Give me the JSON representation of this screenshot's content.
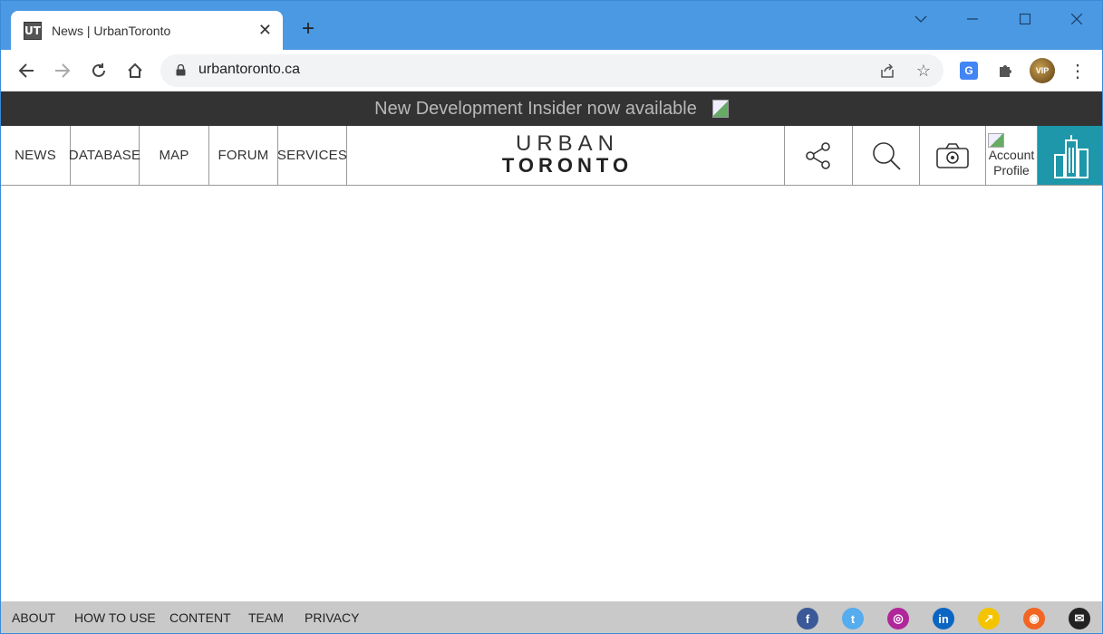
{
  "browser": {
    "tab_title": "News | UrbanToronto",
    "favicon_text": "UT",
    "url": "urbantoronto.ca",
    "avatar_text": "VIP"
  },
  "banner": {
    "text": "New Development Insider now available"
  },
  "nav": {
    "items": [
      "NEWS",
      "DATABASE",
      "MAP",
      "FORUM",
      "SERVICES"
    ],
    "logo_top": "URBAN",
    "logo_bottom": "TORONTO",
    "account_line1": "Account",
    "account_line2": "Profile"
  },
  "footer": {
    "links": [
      "ABOUT",
      "HOW TO USE",
      "CONTENT",
      "TEAM",
      "PRIVACY"
    ],
    "social": [
      {
        "icon": "facebook-icon",
        "glyph": "f",
        "color": "#3b5998"
      },
      {
        "icon": "twitter-icon",
        "glyph": "t",
        "color": "#55acee"
      },
      {
        "icon": "instagram-icon",
        "glyph": "◎",
        "color": "#b0279a"
      },
      {
        "icon": "linkedin-icon",
        "glyph": "in",
        "color": "#0a66c2"
      },
      {
        "icon": "trend-icon",
        "glyph": "↗",
        "color": "#f5c400"
      },
      {
        "icon": "rss-icon",
        "glyph": "◉",
        "color": "#f26522"
      },
      {
        "icon": "email-icon",
        "glyph": "✉",
        "color": "#222222"
      }
    ]
  },
  "colors": {
    "tabbar": "#4a99e2",
    "banner": "#333333",
    "accent": "#1e97aa",
    "footer": "#c9c9c9"
  }
}
